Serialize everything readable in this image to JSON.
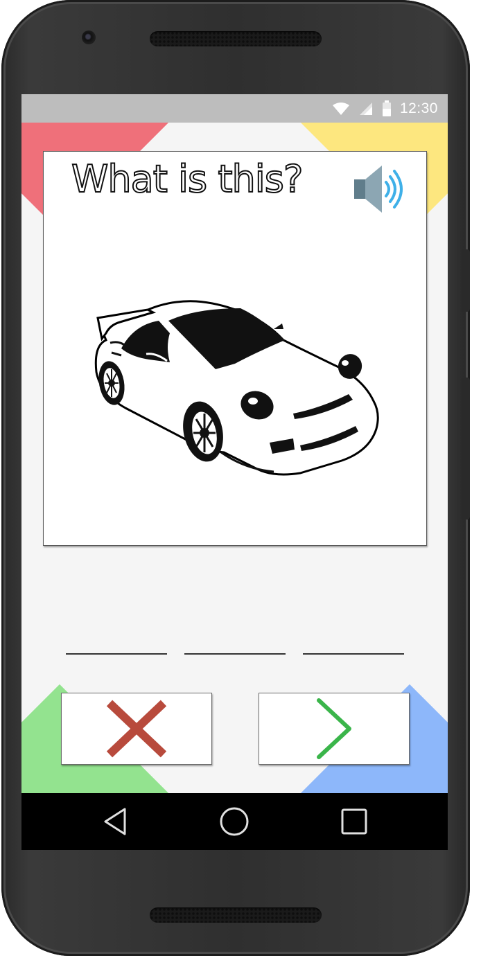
{
  "status_bar": {
    "time": "12:30",
    "icons": [
      "wifi-icon",
      "signal-icon",
      "battery-icon"
    ]
  },
  "colors": {
    "corner_top_left": "#ef707a",
    "corner_top_right": "#fde77f",
    "corner_bottom_left": "#93e38f",
    "corner_bottom_right": "#8db7fa",
    "wrong_mark": "#b84a3c",
    "next_mark": "#3ab54a",
    "speaker_wave": "#3fb0e8"
  },
  "quiz": {
    "question": "What is this?",
    "audio_icon": "speaker-volume-icon",
    "picture": "car-illustration",
    "answer_blanks": [
      "",
      "",
      ""
    ]
  },
  "actions": {
    "wrong_icon": "x-icon",
    "next_icon": "chevron-right-icon"
  },
  "nav_bar": {
    "icons": [
      "back-triangle-icon",
      "home-circle-icon",
      "recent-apps-square-icon"
    ]
  }
}
